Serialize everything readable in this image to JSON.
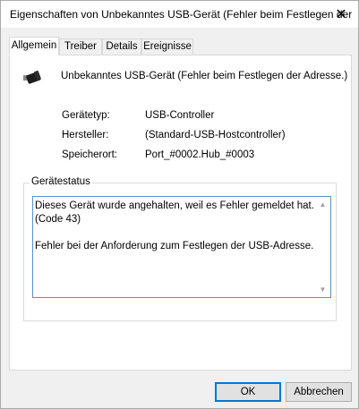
{
  "window": {
    "title": "Eigenschaften von Unbekanntes USB-Gerät (Fehler beim Festlegen der",
    "close_glyph": "✕"
  },
  "tabs": [
    {
      "label": "Allgemein",
      "active": true
    },
    {
      "label": "Treiber",
      "active": false
    },
    {
      "label": "Details",
      "active": false
    },
    {
      "label": "Ereignisse",
      "active": false
    }
  ],
  "device": {
    "icon": "usb-connector-icon",
    "name": "Unbekanntes USB-Gerät (Fehler beim Festlegen der Adresse.)"
  },
  "properties": [
    {
      "label": "Gerätetyp:",
      "value": "USB-Controller"
    },
    {
      "label": "Hersteller:",
      "value": "(Standard-USB-Hostcontroller)"
    },
    {
      "label": "Speicherort:",
      "value": "Port_#0002.Hub_#0003"
    }
  ],
  "status": {
    "group_label": "Gerätestatus",
    "lines": [
      "Dieses Gerät wurde angehalten, weil es Fehler gemeldet hat.",
      "(Code 43)",
      "",
      "Fehler bei der Anforderung zum Festlegen der USB-Adresse."
    ]
  },
  "buttons": {
    "ok": "OK",
    "cancel": "Abbrechen"
  },
  "colors": {
    "focus_border": "#0078d7",
    "textbox_border": "#5b8fd6",
    "dialog_bg": "#f0f0f0"
  }
}
